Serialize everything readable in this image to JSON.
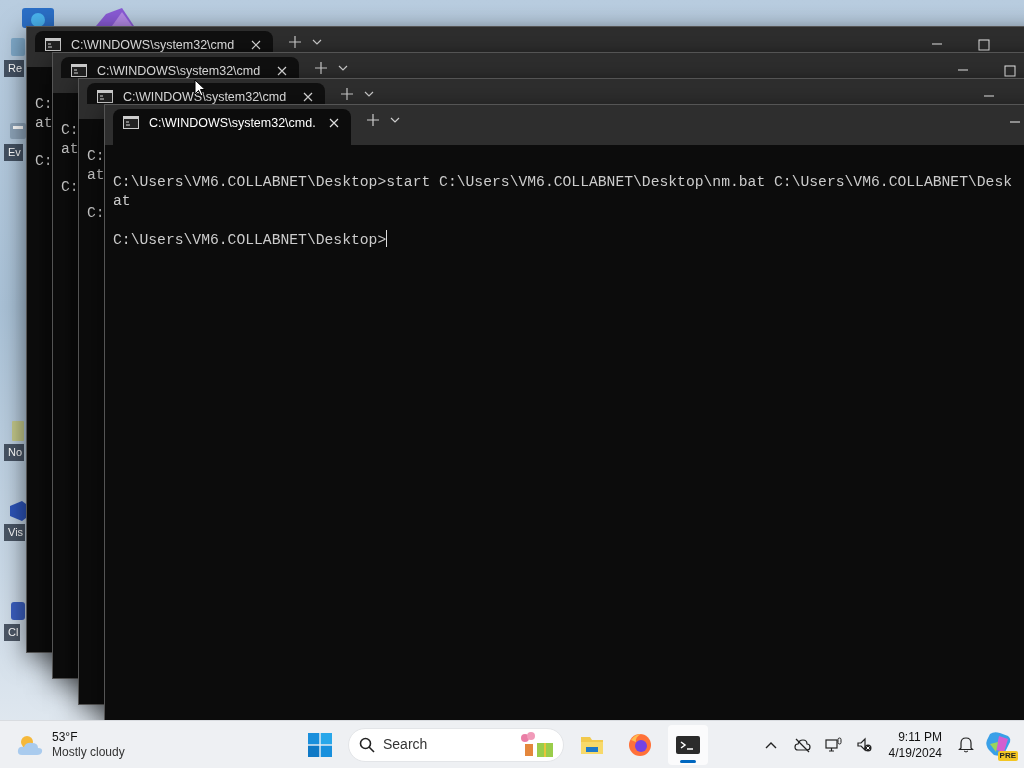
{
  "desktop_icons": [
    {
      "label": "Re",
      "kind": "recycle"
    },
    {
      "label": "Ev",
      "kind": "event"
    },
    {
      "label": "No",
      "kind": "notes"
    },
    {
      "label": "Vis",
      "kind": "studio"
    },
    {
      "label": "Cl",
      "kind": "cloud"
    }
  ],
  "windows": [
    {
      "tab_title": "C:\\WINDOWS\\system32\\cmd",
      "focused": false,
      "controls": [
        {
          "kind": "minimize"
        },
        {
          "kind": "maximize"
        }
      ],
      "output": [
        [
          "C:",
          "at"
        ],
        [
          "C:"
        ]
      ]
    },
    {
      "tab_title": "C:\\WINDOWS\\system32\\cmd",
      "focused": false,
      "controls": [
        {
          "kind": "minimize"
        },
        {
          "kind": "maximize"
        }
      ],
      "output": [
        [
          "C:",
          "at"
        ],
        [
          "C:"
        ]
      ]
    },
    {
      "tab_title": "C:\\WINDOWS\\system32\\cmd",
      "focused": false,
      "controls": [
        {
          "kind": "minimize"
        }
      ],
      "output": [
        [
          "C:",
          "at"
        ],
        [
          "C:"
        ]
      ]
    },
    {
      "tab_title": "C:\\WINDOWS\\system32\\cmd.",
      "focused": true,
      "controls": [
        {
          "kind": "minimize"
        }
      ],
      "output": [
        [
          "C:\\Users\\VM6.COLLABNET\\Desktop>start C:\\Users\\VM6.COLLABNET\\Desktop\\nm.bat C:\\Users\\VM6.COLLABNET\\Desk",
          "at"
        ],
        [
          "C:\\Users\\VM6.COLLABNET\\Desktop>"
        ]
      ]
    }
  ],
  "taskbar": {
    "weather": {
      "temperature": "53°F",
      "condition": "Mostly cloudy"
    },
    "search": {
      "label": "Search"
    },
    "apps": [
      {
        "kind": "files",
        "selected": false
      },
      {
        "kind": "firefox",
        "selected": false
      },
      {
        "kind": "terminal",
        "selected": true
      }
    ],
    "tray": [
      {
        "kind": "chevron"
      },
      {
        "kind": "cloud-off"
      },
      {
        "kind": "network"
      },
      {
        "kind": "muted"
      }
    ],
    "clock": {
      "time": "9:11 PM",
      "date": "4/19/2024"
    },
    "copilot_badge": "PRE"
  }
}
